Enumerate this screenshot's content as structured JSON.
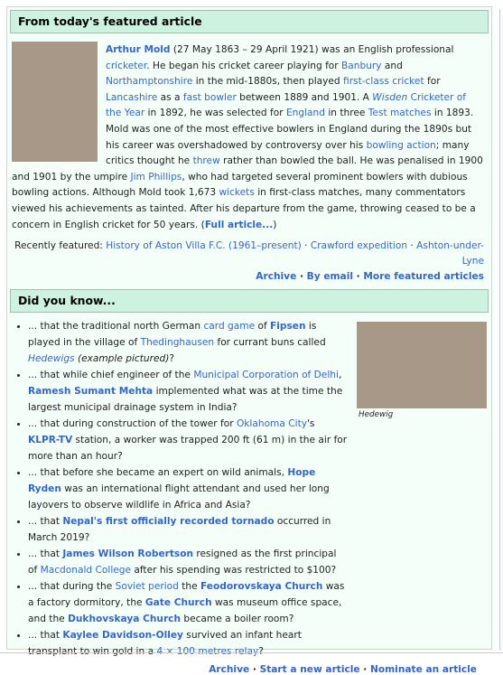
{
  "tfa": {
    "header": "From today's featured article",
    "subject": "Arthur Mold",
    "text_1": " (27 May 1863 – 29 April 1921) was an English professional ",
    "link_cricketer": "cricketer",
    "text_2": ". He began his cricket career playing for ",
    "link_banbury": "Banbury",
    "text_3": " and ",
    "link_northants": "Northamptonshire",
    "text_4": " in the mid-1880s, then played ",
    "link_fc": "first-class cricket",
    "text_5": " for ",
    "link_lancs": "Lancashire",
    "text_6": " as a ",
    "link_fast": "fast bowler",
    "text_7": " between 1889 and 1901. A ",
    "link_wisden_it": "Wisden",
    "link_wisden_rest": " Cricketer of the Year",
    "text_8": " in 1892, he was selected for ",
    "link_england": "England",
    "text_9": " in three ",
    "link_tests": "Test matches",
    "text_10": " in 1893. Mold was one of the most effective bowlers in England during the 1890s but his career was overshadowed by controversy over his ",
    "link_action": "bowling action",
    "text_11": "; many critics thought he ",
    "link_threw": "threw",
    "text_12": " rather than bowled the ball. He was penalised in 1900 and 1901 by the umpire ",
    "link_phillips": "Jim Phillips",
    "text_13": ", who had targeted several prominent bowlers with dubious bowling actions. Although Mold took 1,673 ",
    "link_wickets": "wickets",
    "text_14": " in first-class matches, many commentators viewed his achievements as tainted. After his departure from the game, throwing ceased to be a concern in English cricket for 50 years. (",
    "full_article": "Full article...",
    "text_15": ")",
    "recent_label": "Recently featured: ",
    "recent_1": "History of Aston Villa F.C. (1961–present)",
    "recent_2": "Crawford expedition",
    "recent_3": "Ashton-under-Lyne",
    "sep": " · ",
    "archive": "Archive",
    "by_email": "By email",
    "more_featured": "More featured articles"
  },
  "dyk": {
    "header": "Did you know...",
    "image_caption": "Hedewig",
    "items": [
      {
        "a": "... that the traditional north German ",
        "l1": "card game",
        "b": " of ",
        "l2": "Fipsen",
        "c": " is played in the village of ",
        "l3": "Thedinghausen",
        "d": " for currant buns called ",
        "l4": "Hedewigs",
        "e": " ",
        "f": "(example pictured)",
        "g": "?"
      },
      {
        "a": "... that while chief engineer of the ",
        "l1": "Municipal Corporation of Delhi",
        "b": ", ",
        "l2": "Ramesh Sumant Mehta",
        "c": " implemented what was at the time the largest municipal drainage system in India?"
      },
      {
        "a": "... that during construction of the tower for ",
        "l1": "Oklahoma City",
        "b": "'s ",
        "l2": "KLPR-TV",
        "c": " station, a worker was trapped 200 ft (61 m) in the air for more than an hour?"
      },
      {
        "a": "... that before she became an expert on wild animals, ",
        "l1": "Hope Ryden",
        "b": " was an international flight attendant and used her long layovers to observe wildlife in Africa and Asia?"
      },
      {
        "a": "... that ",
        "l1": "Nepal's first officially recorded tornado",
        "b": " occurred in March 2019?"
      },
      {
        "a": "... that ",
        "l1": "James Wilson Robertson",
        "b": " resigned as the first principal of ",
        "l2": "Macdonald College",
        "c": " after his spending was restricted to $100?"
      },
      {
        "a": "... that during the ",
        "l1": "Soviet period",
        "b": " the ",
        "l2": "Feodorovskaya Church",
        "c": " was a factory dormitory, the ",
        "l3": "Gate Church",
        "d": " was museum office space, and the ",
        "l4": "Dukhovskaya Church",
        "e": " became a boiler room?"
      },
      {
        "a": "... that ",
        "l1": "Kaylee Davidson-Olley",
        "b": " survived an infant heart transplant to win gold in a ",
        "l2": "4 × 100 metres relay",
        "c": "?"
      }
    ],
    "archive": "Archive",
    "start_new": "Start a new article",
    "nominate": "Nominate an article",
    "sep": " · "
  }
}
